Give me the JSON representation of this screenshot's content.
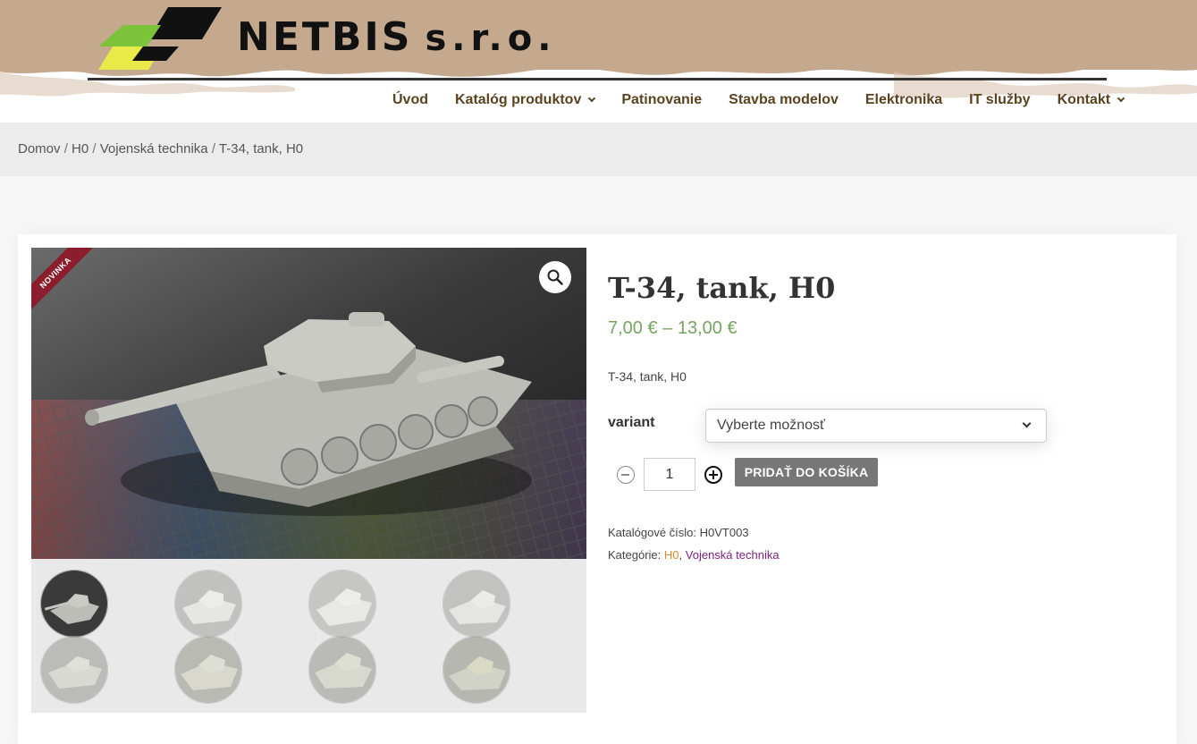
{
  "header": {
    "brand": "NETBIS",
    "brand_suffix": "s.r.o.",
    "nav": [
      {
        "label": "Úvod",
        "dropdown": false
      },
      {
        "label": "Katalóg produktov",
        "dropdown": true
      },
      {
        "label": "Patinovanie",
        "dropdown": false
      },
      {
        "label": "Stavba modelov",
        "dropdown": false
      },
      {
        "label": "Elektronika",
        "dropdown": false
      },
      {
        "label": "IT služby",
        "dropdown": false
      },
      {
        "label": "Kontakt",
        "dropdown": true
      }
    ]
  },
  "breadcrumb": {
    "items": [
      "Domov",
      "H0",
      "Vojenská technika",
      "T-34, tank, H0"
    ],
    "separator": "/"
  },
  "product": {
    "badge": "NOVINKA",
    "title": "T-34, tank, H0",
    "price": "7,00 € – 13,00 €",
    "short_description": "T-34, tank, H0",
    "variant_label": "variant",
    "variant_placeholder": "Vyberte možnosť",
    "quantity": "1",
    "add_to_cart": "PRIDAŤ DO KOŠÍKA",
    "sku_label": "Katalógové číslo:",
    "sku": "H0VT003",
    "categories_label": "Kategórie:",
    "categories": [
      "H0",
      "Vojenská technika"
    ],
    "category_separator": ","
  },
  "colors": {
    "header_band": "#c4a98f",
    "nav_text": "#5a4320",
    "price": "#77a464",
    "badge": "#8b1d2c",
    "button": "#777777",
    "category_1": "#e08a2c",
    "category_2": "#7a1f7a"
  },
  "icons": {
    "zoom": "magnifier-icon",
    "qty_minus": "minus-circle-icon",
    "qty_plus": "plus-circle-icon"
  }
}
